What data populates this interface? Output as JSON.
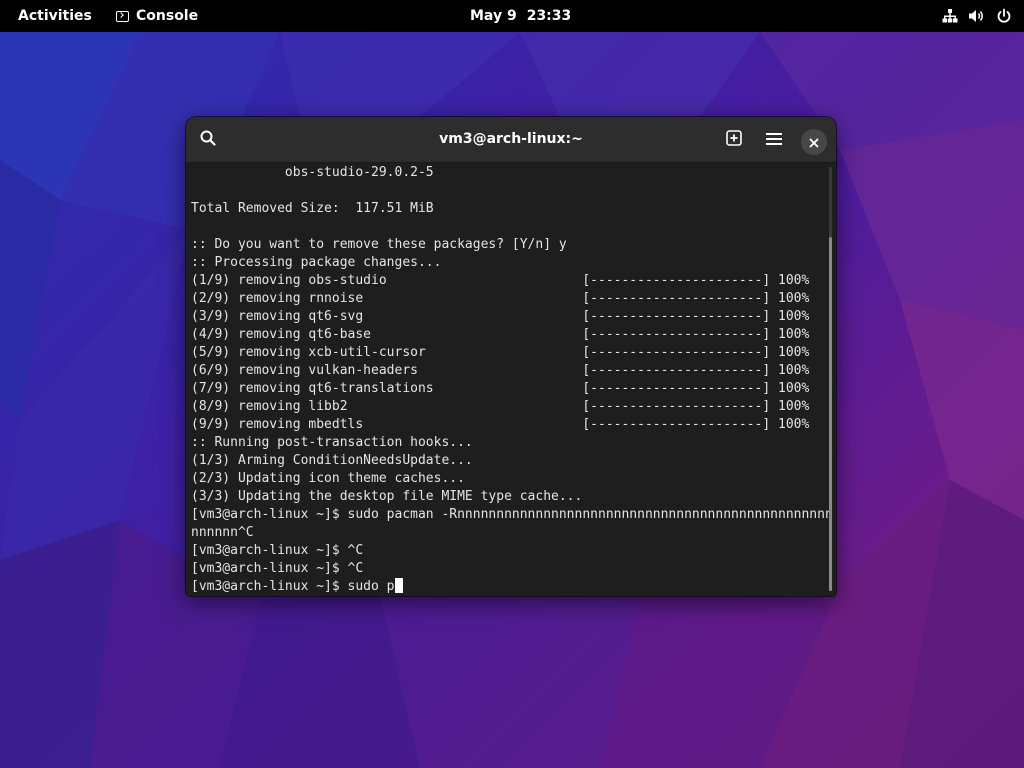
{
  "topbar": {
    "activities_label": "Activities",
    "app_name": "Console",
    "app_icon": "console-icon",
    "date": "May 9",
    "time": "23:33",
    "tray_icons": [
      "network-wired-icon",
      "volume-icon",
      "power-icon"
    ]
  },
  "window": {
    "title": "vm3@arch-linux:~",
    "search_icon": "search-icon",
    "new_tab_icon": "new-tab-icon",
    "menu_icon": "hamburger-menu-icon",
    "close_icon": "close-icon"
  },
  "terminal": {
    "lines": [
      "            obs-studio-29.0.2-5",
      "",
      "Total Removed Size:  117.51 MiB",
      "",
      ":: Do you want to remove these packages? [Y/n] y",
      ":: Processing package changes...",
      "(1/9) removing obs-studio                         [----------------------] 100%",
      "(2/9) removing rnnoise                            [----------------------] 100%",
      "(3/9) removing qt6-svg                            [----------------------] 100%",
      "(4/9) removing qt6-base                           [----------------------] 100%",
      "(5/9) removing xcb-util-cursor                    [----------------------] 100%",
      "(6/9) removing vulkan-headers                     [----------------------] 100%",
      "(7/9) removing qt6-translations                   [----------------------] 100%",
      "(8/9) removing libb2                              [----------------------] 100%",
      "(9/9) removing mbedtls                            [----------------------] 100%",
      ":: Running post-transaction hooks...",
      "(1/3) Arming ConditionNeedsUpdate...",
      "(2/3) Updating icon theme caches...",
      "(3/3) Updating the desktop file MIME type cache...",
      "[vm3@arch-linux ~]$ sudo pacman -Rnnnnnnnnnnnnnnnnnnnnnnnnnnnnnnnnnnnnnnnnnnnnnnnnnnnnnn",
      "nnnnnn^C",
      "[vm3@arch-linux ~]$ ^C",
      "[vm3@arch-linux ~]$ ^C"
    ],
    "prompt_line": "[vm3@arch-linux ~]$ sudo p"
  },
  "colors": {
    "topbar_bg": "#000000",
    "window_bg": "#1e1e1e",
    "headerbar_bg": "#2d2d2d",
    "terminal_fg": "#e4e4e4"
  }
}
